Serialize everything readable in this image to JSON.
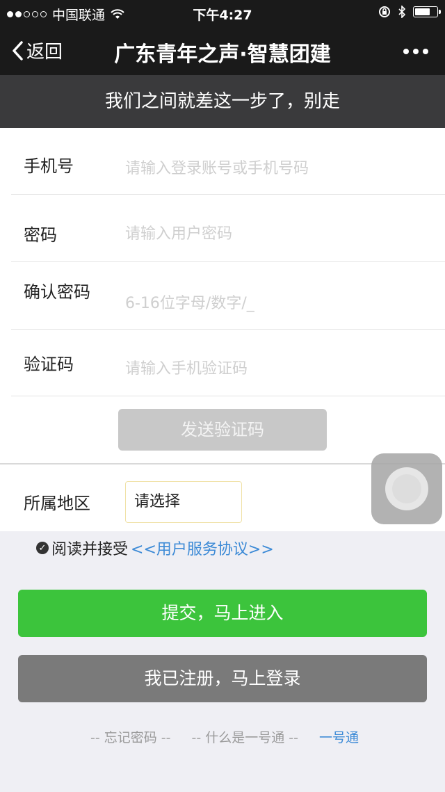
{
  "status_bar": {
    "carrier": "中国联通",
    "time": "下午4:27",
    "battery_level": 0.75
  },
  "nav": {
    "back_label": "返回",
    "title": "广东青年之声·智慧团建"
  },
  "banner": "我们之间就差这一步了，别走",
  "form": {
    "phone": {
      "label": "手机号",
      "placeholder": "请输入登录账号或手机号码"
    },
    "password": {
      "label": "密码",
      "placeholder": "请输入用户密码"
    },
    "confirm": {
      "label": "确认密码",
      "placeholder": "6-16位字母/数字/_"
    },
    "code": {
      "label": "验证码",
      "placeholder": "请输入手机验证码"
    },
    "send_code_label": "发送验证码",
    "region": {
      "label": "所属地区",
      "selected": "请选择"
    }
  },
  "agreement": {
    "prefix": "阅读并接受",
    "link": "<<用户服务协议>>"
  },
  "buttons": {
    "submit": "提交，马上进入",
    "login": "我已注册，马上登录"
  },
  "footer": {
    "forgot": "忘记密码",
    "what": "什么是一号通",
    "account": "一号通"
  },
  "colors": {
    "primary_green": "#3cc43c",
    "link_blue": "#3c8ad6",
    "nav_bg": "#1a1a1a"
  }
}
